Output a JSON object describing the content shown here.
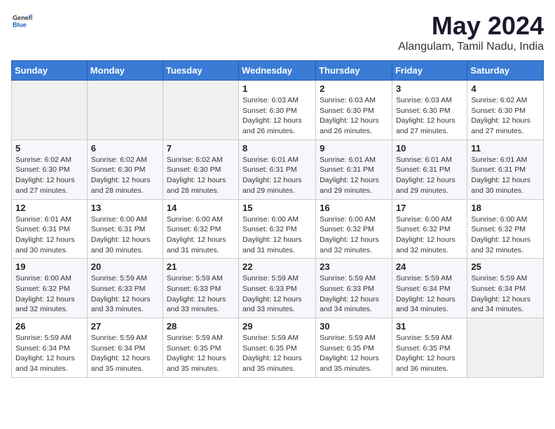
{
  "header": {
    "logo_general": "General",
    "logo_blue": "Blue",
    "month_title": "May 2024",
    "location": "Alangulam, Tamil Nadu, India"
  },
  "weekdays": [
    "Sunday",
    "Monday",
    "Tuesday",
    "Wednesday",
    "Thursday",
    "Friday",
    "Saturday"
  ],
  "weeks": [
    [
      {
        "day": "",
        "sunrise": "",
        "sunset": "",
        "daylight": ""
      },
      {
        "day": "",
        "sunrise": "",
        "sunset": "",
        "daylight": ""
      },
      {
        "day": "",
        "sunrise": "",
        "sunset": "",
        "daylight": ""
      },
      {
        "day": "1",
        "sunrise": "Sunrise: 6:03 AM",
        "sunset": "Sunset: 6:30 PM",
        "daylight": "Daylight: 12 hours and 26 minutes."
      },
      {
        "day": "2",
        "sunrise": "Sunrise: 6:03 AM",
        "sunset": "Sunset: 6:30 PM",
        "daylight": "Daylight: 12 hours and 26 minutes."
      },
      {
        "day": "3",
        "sunrise": "Sunrise: 6:03 AM",
        "sunset": "Sunset: 6:30 PM",
        "daylight": "Daylight: 12 hours and 27 minutes."
      },
      {
        "day": "4",
        "sunrise": "Sunrise: 6:02 AM",
        "sunset": "Sunset: 6:30 PM",
        "daylight": "Daylight: 12 hours and 27 minutes."
      }
    ],
    [
      {
        "day": "5",
        "sunrise": "Sunrise: 6:02 AM",
        "sunset": "Sunset: 6:30 PM",
        "daylight": "Daylight: 12 hours and 27 minutes."
      },
      {
        "day": "6",
        "sunrise": "Sunrise: 6:02 AM",
        "sunset": "Sunset: 6:30 PM",
        "daylight": "Daylight: 12 hours and 28 minutes."
      },
      {
        "day": "7",
        "sunrise": "Sunrise: 6:02 AM",
        "sunset": "Sunset: 6:30 PM",
        "daylight": "Daylight: 12 hours and 28 minutes."
      },
      {
        "day": "8",
        "sunrise": "Sunrise: 6:01 AM",
        "sunset": "Sunset: 6:31 PM",
        "daylight": "Daylight: 12 hours and 29 minutes."
      },
      {
        "day": "9",
        "sunrise": "Sunrise: 6:01 AM",
        "sunset": "Sunset: 6:31 PM",
        "daylight": "Daylight: 12 hours and 29 minutes."
      },
      {
        "day": "10",
        "sunrise": "Sunrise: 6:01 AM",
        "sunset": "Sunset: 6:31 PM",
        "daylight": "Daylight: 12 hours and 29 minutes."
      },
      {
        "day": "11",
        "sunrise": "Sunrise: 6:01 AM",
        "sunset": "Sunset: 6:31 PM",
        "daylight": "Daylight: 12 hours and 30 minutes."
      }
    ],
    [
      {
        "day": "12",
        "sunrise": "Sunrise: 6:01 AM",
        "sunset": "Sunset: 6:31 PM",
        "daylight": "Daylight: 12 hours and 30 minutes."
      },
      {
        "day": "13",
        "sunrise": "Sunrise: 6:00 AM",
        "sunset": "Sunset: 6:31 PM",
        "daylight": "Daylight: 12 hours and 30 minutes."
      },
      {
        "day": "14",
        "sunrise": "Sunrise: 6:00 AM",
        "sunset": "Sunset: 6:32 PM",
        "daylight": "Daylight: 12 hours and 31 minutes."
      },
      {
        "day": "15",
        "sunrise": "Sunrise: 6:00 AM",
        "sunset": "Sunset: 6:32 PM",
        "daylight": "Daylight: 12 hours and 31 minutes."
      },
      {
        "day": "16",
        "sunrise": "Sunrise: 6:00 AM",
        "sunset": "Sunset: 6:32 PM",
        "daylight": "Daylight: 12 hours and 32 minutes."
      },
      {
        "day": "17",
        "sunrise": "Sunrise: 6:00 AM",
        "sunset": "Sunset: 6:32 PM",
        "daylight": "Daylight: 12 hours and 32 minutes."
      },
      {
        "day": "18",
        "sunrise": "Sunrise: 6:00 AM",
        "sunset": "Sunset: 6:32 PM",
        "daylight": "Daylight: 12 hours and 32 minutes."
      }
    ],
    [
      {
        "day": "19",
        "sunrise": "Sunrise: 6:00 AM",
        "sunset": "Sunset: 6:32 PM",
        "daylight": "Daylight: 12 hours and 32 minutes."
      },
      {
        "day": "20",
        "sunrise": "Sunrise: 5:59 AM",
        "sunset": "Sunset: 6:33 PM",
        "daylight": "Daylight: 12 hours and 33 minutes."
      },
      {
        "day": "21",
        "sunrise": "Sunrise: 5:59 AM",
        "sunset": "Sunset: 6:33 PM",
        "daylight": "Daylight: 12 hours and 33 minutes."
      },
      {
        "day": "22",
        "sunrise": "Sunrise: 5:59 AM",
        "sunset": "Sunset: 6:33 PM",
        "daylight": "Daylight: 12 hours and 33 minutes."
      },
      {
        "day": "23",
        "sunrise": "Sunrise: 5:59 AM",
        "sunset": "Sunset: 6:33 PM",
        "daylight": "Daylight: 12 hours and 34 minutes."
      },
      {
        "day": "24",
        "sunrise": "Sunrise: 5:59 AM",
        "sunset": "Sunset: 6:34 PM",
        "daylight": "Daylight: 12 hours and 34 minutes."
      },
      {
        "day": "25",
        "sunrise": "Sunrise: 5:59 AM",
        "sunset": "Sunset: 6:34 PM",
        "daylight": "Daylight: 12 hours and 34 minutes."
      }
    ],
    [
      {
        "day": "26",
        "sunrise": "Sunrise: 5:59 AM",
        "sunset": "Sunset: 6:34 PM",
        "daylight": "Daylight: 12 hours and 34 minutes."
      },
      {
        "day": "27",
        "sunrise": "Sunrise: 5:59 AM",
        "sunset": "Sunset: 6:34 PM",
        "daylight": "Daylight: 12 hours and 35 minutes."
      },
      {
        "day": "28",
        "sunrise": "Sunrise: 5:59 AM",
        "sunset": "Sunset: 6:35 PM",
        "daylight": "Daylight: 12 hours and 35 minutes."
      },
      {
        "day": "29",
        "sunrise": "Sunrise: 5:59 AM",
        "sunset": "Sunset: 6:35 PM",
        "daylight": "Daylight: 12 hours and 35 minutes."
      },
      {
        "day": "30",
        "sunrise": "Sunrise: 5:59 AM",
        "sunset": "Sunset: 6:35 PM",
        "daylight": "Daylight: 12 hours and 35 minutes."
      },
      {
        "day": "31",
        "sunrise": "Sunrise: 5:59 AM",
        "sunset": "Sunset: 6:35 PM",
        "daylight": "Daylight: 12 hours and 36 minutes."
      },
      {
        "day": "",
        "sunrise": "",
        "sunset": "",
        "daylight": ""
      }
    ]
  ]
}
